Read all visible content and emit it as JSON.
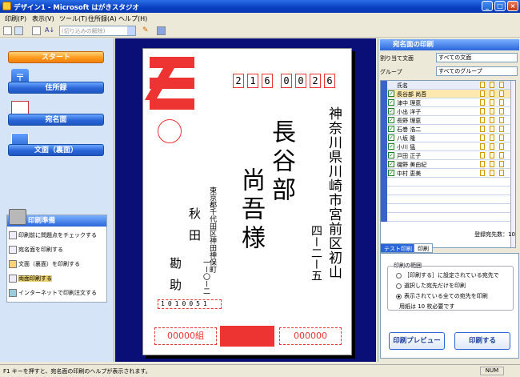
{
  "window": {
    "title": "デザイン1 - Microsoft はがきスタジオ"
  },
  "menu": [
    "印刷(P)",
    "表示(V)",
    "ツール(T)",
    "住所録(A)",
    "ヘルプ(H)"
  ],
  "toolbar": {
    "combo_placeholder": "(切り込みの解除)"
  },
  "nav": {
    "start": "スタート",
    "address_book": "住所録",
    "address_side": "宛名面",
    "message_side": "文面（裏面）",
    "print_prep": "印刷準備"
  },
  "print_items": [
    "印刷前に問題点をチェックする",
    "宛名面を印刷する",
    "文面（裏面）を印刷する",
    "両面印刷する",
    "インターネットで印刷注文する"
  ],
  "card": {
    "recipient_zip": [
      "2",
      "1",
      "6",
      "0",
      "0",
      "2",
      "6"
    ],
    "recipient_address_1": "神奈川県川崎市宮前区初山",
    "recipient_address_2": "四ー二ー五",
    "recipient_name_1": "長谷部",
    "recipient_name_2": "尚吾様",
    "sender_address": "東京都千代田区神田神保町",
    "sender_address_2": "一ー〇ー二",
    "sender_name_1": "秋田",
    "sender_name_2": "勘助",
    "sender_zip": [
      "1",
      "0",
      "1",
      "0",
      "0",
      "5",
      "1"
    ],
    "stamp_value_left": "00000組",
    "stamp_value_right": "000000"
  },
  "right": {
    "title": "宛名面の印刷",
    "assigned_label": "割り当て文面",
    "assigned_value": "すべての文面",
    "group_label": "グループ",
    "group_value": "すべてのグループ",
    "col_name": "氏名",
    "recipients": [
      "長谷部 尚吾",
      "津中 理恵",
      "小出 洋子",
      "長野 理恵",
      "石巻 浩二",
      "八坂 隆",
      "小川 猛",
      "戸田 正子",
      "磯野 美由紀",
      "中村 恵美"
    ],
    "count_label": "登録宛先数：10",
    "tab_test": "テスト印刷",
    "tab_print": "印刷",
    "range_label": "印刷の範囲",
    "radio_1": "［印刷する］に設定されている宛先で",
    "radio_2": "選択した宛先だけを印刷",
    "radio_3": "表示されている全ての宛先を印刷",
    "paper_note": "用紙は 10 枚必要です",
    "preview_button": "印刷プレビュー",
    "print_button": "印刷する"
  },
  "status": {
    "text": "F1 キーを押すと、宛名面の印刷のヘルプが表示されます。",
    "num": "NUM"
  }
}
